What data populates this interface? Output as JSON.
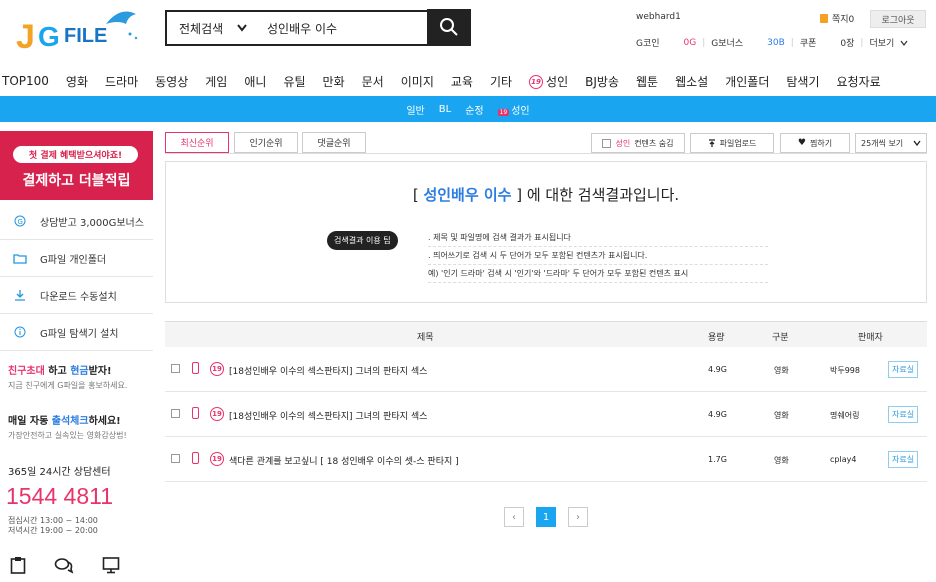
{
  "search": {
    "category": "전체검색",
    "query": "성인배우 이수"
  },
  "user": {
    "name": "webhard1",
    "notes": "쪽지0",
    "logout": "로그아웃"
  },
  "points": [
    "G코인",
    "0G",
    "G보너스",
    "30B",
    "쿠폰",
    "0장",
    "더보기"
  ],
  "nav": [
    "TOP100",
    "영화",
    "드라마",
    "동영상",
    "게임",
    "애니",
    "유틸",
    "만화",
    "문서",
    "이미지",
    "교육",
    "기타",
    "성인",
    "BJ방송",
    "웹툰",
    "웹소설",
    "개인폴더",
    "탐색기",
    "요청자료"
  ],
  "subnav": [
    "일반",
    "BL",
    "순정",
    "성인"
  ],
  "promo": {
    "pill": "첫 결제 혜택받으셔야죠!",
    "big": "결제하고 더블적립"
  },
  "sidebar": [
    "상담받고 3,000G보너스",
    "G파일 개인폴더",
    "다운로드 수동설치",
    "G파일 탐색기 설치"
  ],
  "invite": {
    "a": "친구초대",
    "b": " 하고 ",
    "c": "현금",
    "d": "받자!",
    "sub": "지금 친구에게 G파일을 홍보하세요."
  },
  "checkin": {
    "a": "매일 자동 ",
    "b": "출석체크",
    "c": "하세요!",
    "sub": "가장안전하고 실속있는 영화감상법!"
  },
  "support": {
    "label": "365일 24시간 상담센터",
    "phone": "1544 4811",
    "hours1": "점심시간 13:00 ~ 14:00",
    "hours2": "저녁시간 19:00 ~ 20:00"
  },
  "tabs": [
    "최신순위",
    "인기순위",
    "댓글순위"
  ],
  "toolbar": {
    "hide": "컨텐츠 숨김",
    "hide_prefix": "성인",
    "upload": "파일업로드",
    "fav": "찜하기",
    "view": "25개씩 보기"
  },
  "result": {
    "pre": "[ ",
    "keyword": "성인배우 이수",
    "post": " ] 에 대한 검색결과입니다.",
    "tip": "검색결과 이용 팁",
    "tips": [
      ". 제목 및 파일명에 검색 결과가 표시됩니다",
      ". 띄어쓰기로 검색 시 두 단어가 모두 포함된 컨텐츠가 표시됩니다.",
      "예) '인기 드라마' 검색 시 '인기'와 '드라마' 두 단어가 모두 포함된 컨텐츠 표시"
    ]
  },
  "table": {
    "headers": [
      "제목",
      "용량",
      "구분",
      "판매자"
    ],
    "rows": [
      {
        "title": "[18성인배우 이수의 섹스판타지] 그녀의 판타지 섹스",
        "size": "4.9G",
        "kind": "영화",
        "seller": "박두998",
        "badge": "자료실"
      },
      {
        "title": "[18성인배우 이수의 섹스판타지] 그녀의 판타지 섹스",
        "size": "4.9G",
        "kind": "영화",
        "seller": "명쉐어링",
        "badge": "자료실"
      },
      {
        "title": "색다른 관계를 보고싶니 [ 18 성인배우 이수의 셋-스 판타지 ]",
        "size": "1.7G",
        "kind": "영화",
        "seller": "cplay4",
        "badge": "자료실"
      }
    ]
  },
  "pagination": {
    "prev": "‹",
    "current": "1",
    "next": "›"
  },
  "logo_text": "G FILE"
}
